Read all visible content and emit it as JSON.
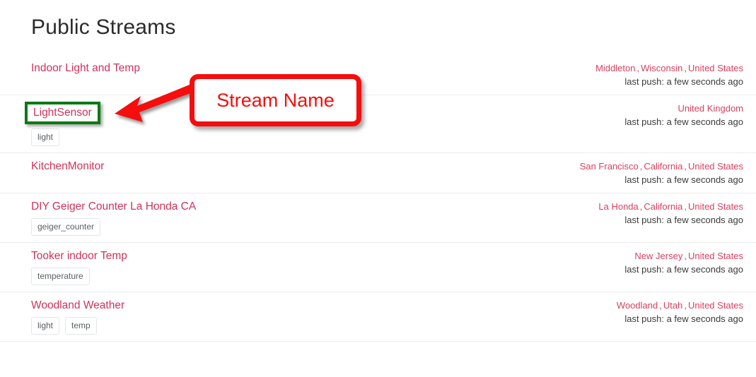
{
  "page": {
    "title": "Public Streams"
  },
  "labels": {
    "last_push_prefix": "last push:",
    "location_separator": ","
  },
  "colors": {
    "stream_link": "#cf335a",
    "location_link": "#d8405f",
    "highlight_border": "#0b7a12",
    "annotation_red": "#f60d0d",
    "row_divider": "#eceded",
    "title_text": "#2b2b2b"
  },
  "annotation": {
    "label": "Stream Name",
    "arrow": "arrow-left",
    "target": "LightSensor"
  },
  "streams": [
    {
      "name": "Indoor Light and Temp",
      "tags": [],
      "location": [
        "Middleton",
        "Wisconsin",
        "United States"
      ],
      "last_push": "last push: a few seconds ago",
      "highlighted": false
    },
    {
      "name": "LightSensor",
      "tags": [
        "light"
      ],
      "location": [
        "United Kingdom"
      ],
      "last_push": "last push: a few seconds ago",
      "highlighted": true
    },
    {
      "name": "KitchenMonitor",
      "tags": [],
      "location": [
        "San Francisco",
        "California",
        "United States"
      ],
      "last_push": "last push: a few seconds ago",
      "highlighted": false
    },
    {
      "name": "DIY Geiger Counter La Honda CA",
      "tags": [
        "geiger_counter"
      ],
      "location": [
        "La Honda",
        "California",
        "United States"
      ],
      "last_push": "last push: a few seconds ago",
      "highlighted": false
    },
    {
      "name": "Tooker indoor Temp",
      "tags": [
        "temperature"
      ],
      "location": [
        "New Jersey",
        "United States"
      ],
      "last_push": "last push: a few seconds ago",
      "highlighted": false
    },
    {
      "name": "Woodland Weather",
      "tags": [
        "light",
        "temp"
      ],
      "location": [
        "Woodland",
        "Utah",
        "United States"
      ],
      "last_push": "last push: a few seconds ago",
      "highlighted": false
    }
  ]
}
